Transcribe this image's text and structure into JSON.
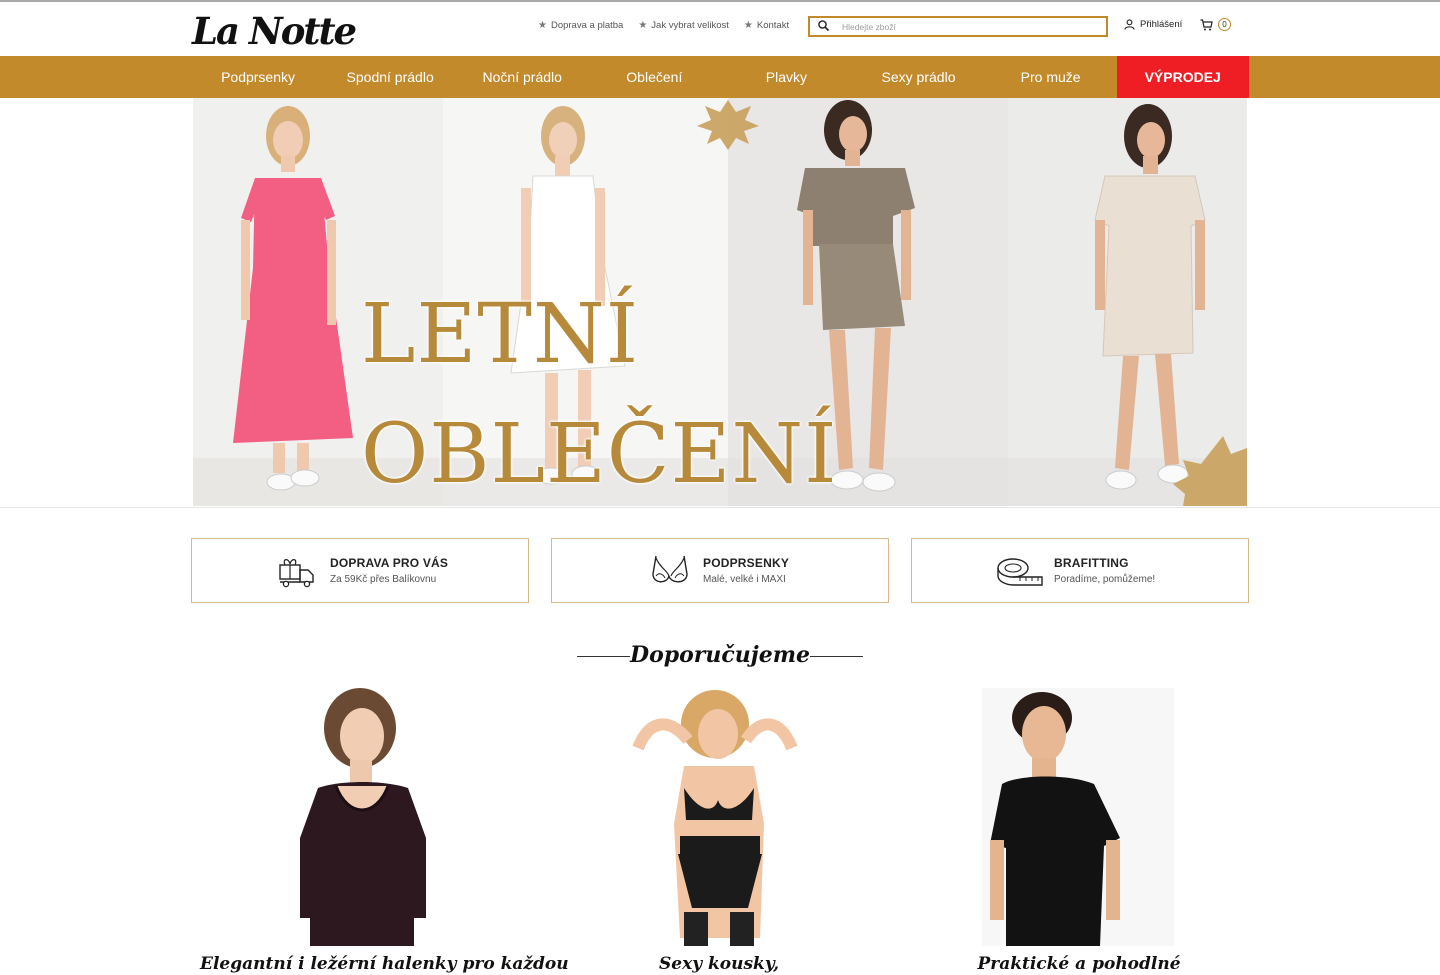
{
  "brand": {
    "logo": "La Notte",
    "accent": "#c28a2b",
    "sale_color": "#ee1e24"
  },
  "header": {
    "links": [
      {
        "label": "Doprava a platba",
        "icon": "star-icon"
      },
      {
        "label": "Jak vybrat velikost",
        "icon": "star-icon"
      },
      {
        "label": "Kontakt",
        "icon": "star-icon"
      }
    ],
    "search": {
      "placeholder": "Hledejte zboží",
      "value": ""
    },
    "login_label": "Přihlášení",
    "cart_count": "0"
  },
  "nav": {
    "items": [
      {
        "label": "Podprsenky"
      },
      {
        "label": "Spodní prádlo"
      },
      {
        "label": "Noční prádlo"
      },
      {
        "label": "Oblečení"
      },
      {
        "label": "Plavky"
      },
      {
        "label": "Sexy prádlo"
      },
      {
        "label": "Pro muže"
      },
      {
        "label": "VÝPRODEJ",
        "highlight": true
      }
    ]
  },
  "hero": {
    "line1": "LETNÍ",
    "line2": "OBLEČENÍ",
    "image_subjects": [
      "pink-maxi-dress",
      "white-slip-dress",
      "taupe-mini-dress",
      "beige-tshirt-dress"
    ]
  },
  "info_boxes": [
    {
      "title": "DOPRAVA PRO VÁS",
      "subtitle": "Za 59Kč přes Balíkovnu",
      "icon": "delivery-truck-icon"
    },
    {
      "title": "PODPRSENKY",
      "subtitle": "Malé, velké i MAXI",
      "icon": "bra-icon"
    },
    {
      "title": "BRAFITTING",
      "subtitle": "Poradíme, pomůžeme!",
      "icon": "measuring-tape-icon"
    }
  ],
  "recommended": {
    "title": "Doporučujeme",
    "products": [
      {
        "caption": "Elegantní i ležérní halenky pro každou",
        "image": "black-lace-blouse"
      },
      {
        "caption": "Sexy kousky,",
        "image": "black-lingerie-set"
      },
      {
        "caption": "Praktické a pohodlné",
        "image": "mens-black-tshirt"
      }
    ]
  }
}
